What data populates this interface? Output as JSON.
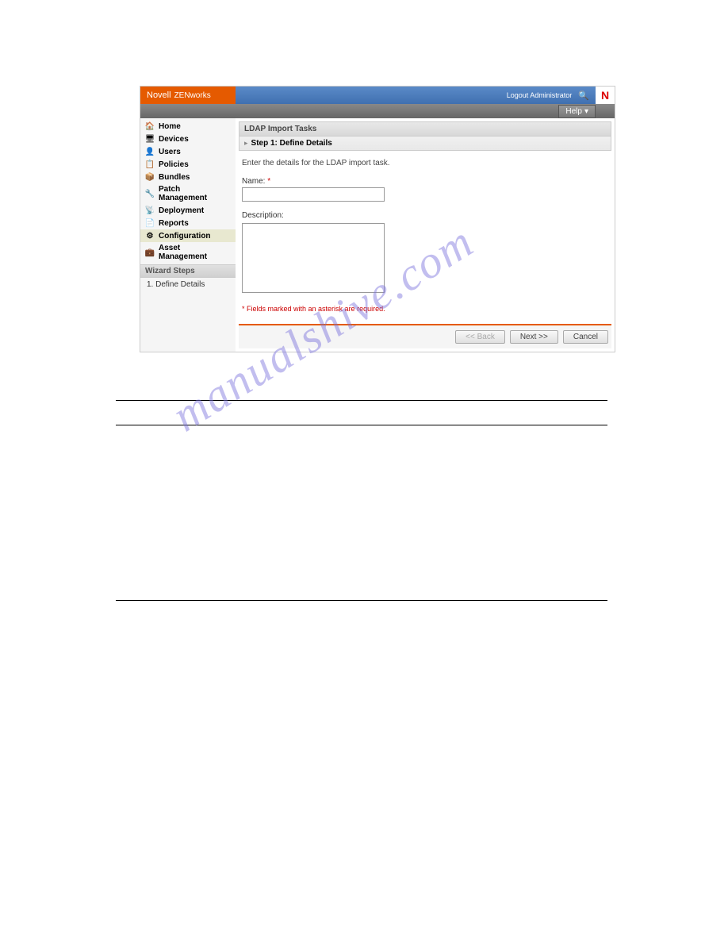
{
  "brand": {
    "name": "Novell",
    "product": "ZENworks"
  },
  "topbar": {
    "logout": "Logout Administrator"
  },
  "help": {
    "label": "Help"
  },
  "sidebar": {
    "items": [
      {
        "label": "Home",
        "icon": "🏠"
      },
      {
        "label": "Devices",
        "icon": "🖥"
      },
      {
        "label": "Users",
        "icon": "👤"
      },
      {
        "label": "Policies",
        "icon": "📋"
      },
      {
        "label": "Bundles",
        "icon": "📦"
      },
      {
        "label": "Patch Management",
        "icon": "🔧"
      },
      {
        "label": "Deployment",
        "icon": "📡"
      },
      {
        "label": "Reports",
        "icon": "📄"
      },
      {
        "label": "Configuration",
        "icon": "⚙"
      },
      {
        "label": "Asset Management",
        "icon": "💼"
      }
    ],
    "wizard_header": "Wizard Steps",
    "wizard_steps": [
      "1. Define Details"
    ]
  },
  "panel": {
    "title": "LDAP Import Tasks",
    "step_label": "Step 1: Define Details",
    "instruction": "Enter the details for the LDAP import task.",
    "name_label": "Name:",
    "name_value": "",
    "description_label": "Description:",
    "description_value": "",
    "required_note": "Fields marked with an asterisk are required.",
    "buttons": {
      "back": "<< Back",
      "next": "Next >>",
      "cancel": "Cancel"
    }
  },
  "watermark": "manualshive.com"
}
